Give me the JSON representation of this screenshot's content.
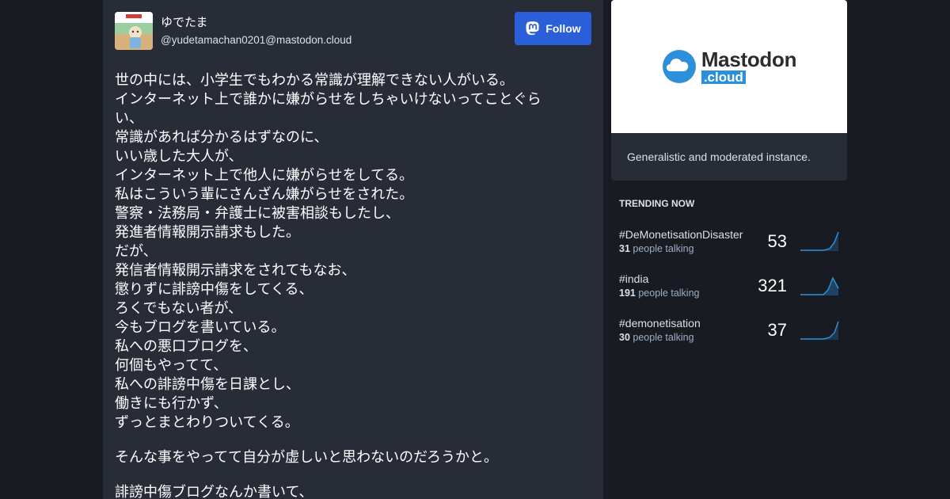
{
  "post": {
    "display_name": "ゆでたま",
    "handle": "@yudetamachan0201@mastodon.cloud",
    "follow_label": "Follow",
    "paragraphs": [
      "世の中には、小学生でもわかる常識が理解できない人がいる。\nインターネット上で誰かに嫌がらせをしちゃいけないってことぐら\nい、\n常識があれば分かるはずなのに、\nいい歳した大人が、\nインターネット上で他人に嫌がらせをしてる。\n私はこういう輩にさんざん嫌がらせをされた。\n警察・法務局・弁護士に被害相談もしたし、\n発進者情報開示請求もした。\nだが、\n発信者情報開示請求をされてもなお、\n懲りずに誹謗中傷をしてくる、\nろくでもない者が、\n今もブログを書いている。\n私への悪口ブログを、\n何個もやってて、\n私への誹謗中傷を日課とし、\n働きにも行かず、\nずっとまとわりついてくる。",
      "そんな事をやってて自分が虚しいと思わないのだろうかと。",
      "誹謗中傷ブログなんか書いて、"
    ]
  },
  "server": {
    "logo_name": "Mastodon",
    "logo_domain": ".cloud",
    "description": "Generalistic and moderated instance.",
    "brand_color": "#2b90d9"
  },
  "trending": {
    "title": "TRENDING NOW",
    "people_suffix": "people talking",
    "items": [
      {
        "tag": "#DeMonetisationDisaster",
        "people": "31",
        "count": "53"
      },
      {
        "tag": "#india",
        "people": "191",
        "count": "321"
      },
      {
        "tag": "#demonetisation",
        "people": "30",
        "count": "37"
      }
    ]
  },
  "colors": {
    "background": "#191b22",
    "card": "#282c37",
    "follow_button": "#2b5fd9",
    "sparkline": "#2b90d9"
  }
}
